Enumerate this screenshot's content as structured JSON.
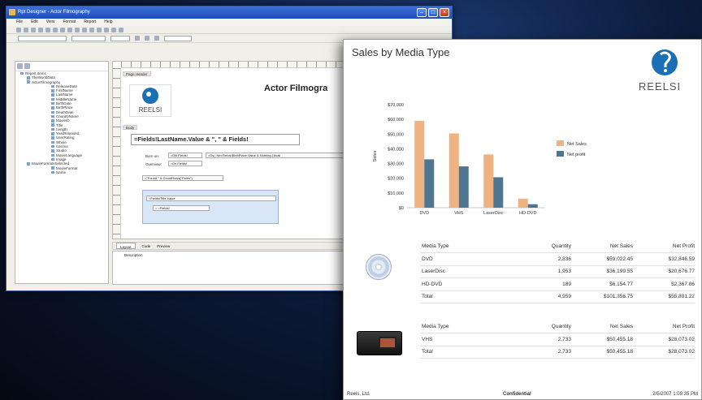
{
  "designer": {
    "window_title": "Rpt Designer - Actor Filmography",
    "menu": [
      "File",
      "Edit",
      "View",
      "Format",
      "Report",
      "Help"
    ],
    "tree_items": [
      {
        "label": "Report Items",
        "level": 0
      },
      {
        "label": "TheWorldData",
        "level": 1
      },
      {
        "label": "ActorFilmography",
        "level": 1
      },
      {
        "label": "ReleaseDate",
        "level": 3
      },
      {
        "label": "FirstName",
        "level": 3
      },
      {
        "label": "LastName",
        "level": 3
      },
      {
        "label": "MiddleName",
        "level": 3
      },
      {
        "label": "BirthDate",
        "level": 3
      },
      {
        "label": "BirthPlace",
        "level": 3
      },
      {
        "label": "DeathDate",
        "level": 3
      },
      {
        "label": "CountryName",
        "level": 3
      },
      {
        "label": "MovieID",
        "level": 3
      },
      {
        "label": "Title",
        "level": 3
      },
      {
        "label": "Length",
        "level": 3
      },
      {
        "label": "YearReleased",
        "level": 3
      },
      {
        "label": "UserRating",
        "level": 3
      },
      {
        "label": "Whine",
        "level": 3
      },
      {
        "label": "Genres",
        "level": 3
      },
      {
        "label": "Studio",
        "level": 3
      },
      {
        "label": "MovieLanguage",
        "level": 3
      },
      {
        "label": "Image",
        "level": 3
      },
      {
        "label": "MovieFormatsSelected",
        "level": 1
      },
      {
        "label": "MovieFormat",
        "level": 3
      },
      {
        "label": "Name",
        "level": 3
      }
    ],
    "page_header_label": "Page Header",
    "page_title": "Actor Filmogra",
    "body_label": "Body",
    "field_expression": "=Fields!LastName.Value & \", \" & Fields!",
    "born_on_label": "Born on:",
    "born_on_value": "=DB Fields!",
    "born_in_value": "=Ds | Net Fields!BirthPlace.Value & Nothing | Avail",
    "overview_label": "Overview:",
    "overview_value": "=Ds Fields!",
    "found_expr": "=\"Found \" & CountRows(\"Roles\")",
    "sub_field": "=Fields!Title.Value",
    "sub_field2": "= =Fields!",
    "tabs": [
      "Layout",
      "Code",
      "Preview"
    ],
    "errors_label": "Description"
  },
  "report": {
    "title": "Sales by Media Type",
    "logo_text": "REELSI",
    "table1": {
      "headers": [
        "Media Type",
        "Quantity",
        "Net Sales",
        "Net Profit"
      ],
      "rows": [
        [
          "DVD",
          "2,836",
          "$59,022.45",
          "$32,846.59"
        ],
        [
          "LaserDisc",
          "1,953",
          "$36,199.55",
          "$20,676.77"
        ],
        [
          "HD-DVD",
          "189",
          "$6,154.77",
          "$2,367.86"
        ],
        [
          "Total",
          "4,959",
          "$101,356.75",
          "$55,891.22"
        ]
      ]
    },
    "table2": {
      "headers": [
        "Media Type",
        "Quantity",
        "Net Sales",
        "Net Profit"
      ],
      "rows": [
        [
          "VHS",
          "2,733",
          "$50,455.18",
          "$28,073.02"
        ],
        [
          "Total",
          "2,733",
          "$50,455.18",
          "$28,073.02"
        ]
      ]
    },
    "footer_left": "Reels, Ltd.",
    "footer_center": "Confidential",
    "footer_right": "2/5/2007 1:09:35 PM"
  },
  "chart_data": {
    "type": "bar",
    "categories": [
      "DVD",
      "VHS",
      "LaserDisc",
      "HD-DVD"
    ],
    "series": [
      {
        "name": "Net Sales",
        "values": [
          59022,
          50455,
          36200,
          6155
        ],
        "color": "#efb283"
      },
      {
        "name": "Net profit",
        "values": [
          32847,
          28073,
          20677,
          2368
        ],
        "color": "#4f7590"
      }
    ],
    "ylabel": "Sales",
    "ylim": [
      0,
      70000
    ],
    "ytick_labels": [
      "$0",
      "$10,000",
      "$20,000",
      "$30,000",
      "$40,000",
      "$50,000",
      "$60,000",
      "$70,000"
    ],
    "legend": "right",
    "grid": false
  }
}
